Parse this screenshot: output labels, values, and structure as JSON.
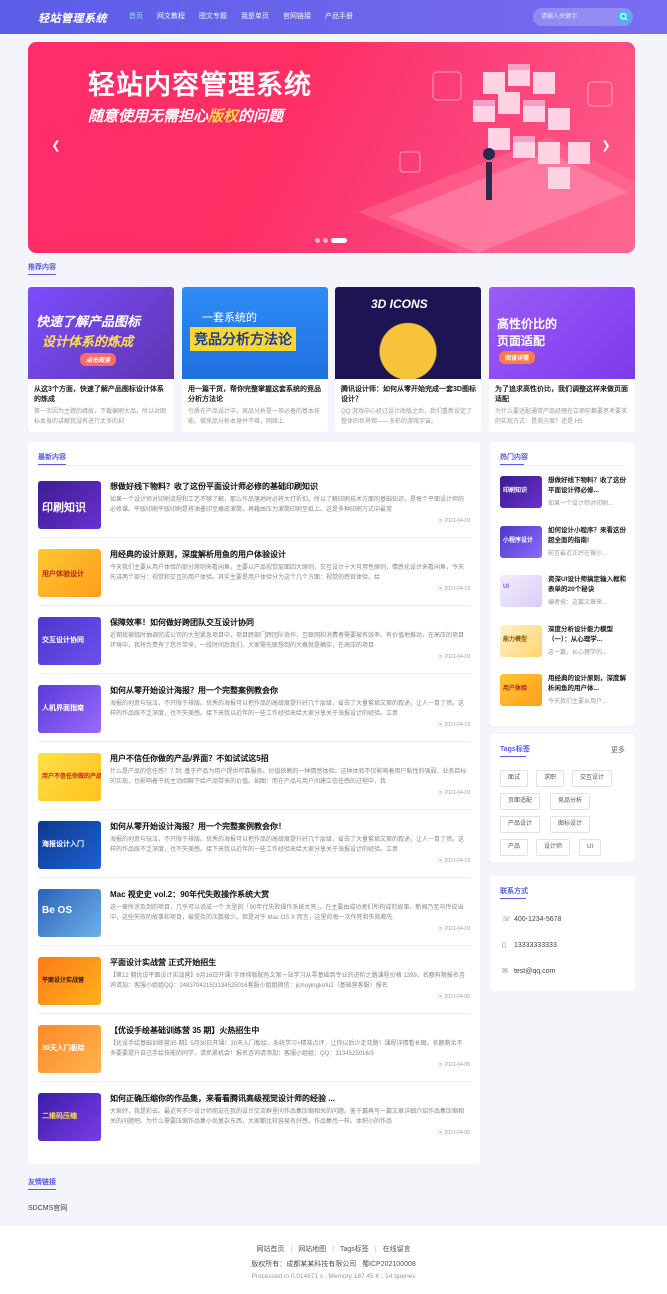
{
  "header": {
    "logo": "轻站管理系统",
    "nav": [
      "首页",
      "网文教程",
      "图文专题",
      "我是单页",
      "官网链接",
      "产品手册"
    ],
    "active_nav": "首页",
    "search_placeholder": "请输入关键字"
  },
  "banner": {
    "title": "轻站内容管理系统",
    "subtitle_pre": "随意使用无需担心",
    "subtitle_highlight": "版权",
    "subtitle_post": "的问题",
    "slides": 3,
    "active_slide": 3
  },
  "recommend": {
    "title": "推荐内容",
    "items": [
      {
        "image_text": [
          "快速了解产品图标",
          "设计体系的炼成",
          "点击阅读"
        ],
        "title": "从这3个方面，快速了解产品图标设计体系的炼成",
        "desc": "第一次因为主题的缘故，下载偏刷大品。所以对图标本身的讲解我没有进行太多的刻"
      },
      {
        "image_text": [
          "一套系统的",
          "竞品分析方法论"
        ],
        "title": "用一篇干货，帮你完整掌握这套系统的竞品分析方法论",
        "desc": "引质在产品设计中，竞品分析是一项必备的基本技能。做竞品分析本身并不难，网络上"
      },
      {
        "image_text": [
          "3D ICONS"
        ],
        "title": "腾讯设计师：如何从零开始完成一套3D图标设计？",
        "desc": "QQ 游戏中心经过设计改版之后，我们重新设定了整体的世界观——多彩的游戏宇宙。"
      },
      {
        "image_text": [
          "高性价比的",
          "页面适配",
          "阅读详情"
        ],
        "title": "为了追求高性价比，我们调整这样来做页面适配",
        "desc": "为什么要适配通常产品经理在立项前都要思考要求的实现方式：是测方案？还是 H5"
      }
    ]
  },
  "latest": {
    "title": "最新内容",
    "items": [
      {
        "thumb": "印刷知识",
        "title": "想做好线下物料？收了这份平面设计师必修的基础印刷知识",
        "desc": "如果一个设计师对印刷流程和工艺不够了解，那么作品落地时必将大打折扣。所以了解印刷技术方面的基础知识，是每个平面设计师的必修课。平版印刷平版印刷是将油墨印至橡皮滚筒，再藉由压力滚筒印刷至纸上。这是多种印刷方式中最常",
        "date": "2021-04-19"
      },
      {
        "thumb": "用户体验设计",
        "title": "用经典的设计原则，深度解析用鱼的用户体验设计",
        "desc": "今天我们主要从用户体验的部分原则来看闲鱼，主要以产品视觉层面四大原则，交互设计十大可用性原则，情感化设计来看闲鱼，今天先讲两个部分：视觉和交互的用户体验。其实主要是用户体验分为这个几个方面：视觉的感官体验，给",
        "date": "2021-04-19"
      },
      {
        "thumb": "交互设计协同",
        "title": "保障效率！如何做好跨团队交互设计协同",
        "desc": "近期我被临时抽调完成公司的大型紧急项目中，项目跨部门跨团队协作，互联网和消费者需要被有效率、有价值地推动，在高压的项目环境中，我将负责有了您许带来，一段时间后我们、大家需先联想到的大概就是确实，在高压的项目",
        "date": "2021-04-19"
      },
      {
        "thumb": "人机界面指南",
        "title": "如何从零开始设计海报？用一个完整案例教会你",
        "desc": "海报的创意与玩法，不只限于排版。优秀的海报可以把作品的高级度提升好几个层级，省去了大量繁琐文案的叙述，让人一目了然。这样的作品既不乏深度，也不失美感。接下来我以近年的一些工作经验来给大家分享关于海报设计的经验。立意",
        "date": "2021-04-19"
      },
      {
        "thumb": "用户不信任你做的产品?",
        "title": "用户不信任你做的产品/界面？不如试试这5招",
        "desc": "什么是产品的信任感？7 到: 基于产品为用户提供可靠服务。价值依赖的一种情感体验。这种体验不仅影响着用户黏性的强弱，业务目标的实现，也影响着干扰主动阅聊下给产品带来的价值。如图：而在产品与用户间建立信任感的过程中，我",
        "date": "2021-04-19"
      },
      {
        "thumb": "海报设计入门",
        "title": "如何从零开始设计海报？用一个完整案例教会你！",
        "desc": "海报的创意与玩法，不只限于排版。优秀的海报可以把作品的高级度提升好几个层级，省去了大量繁琐文案的叙述，让人一目了然。这样的作品既不乏深度，也不失美感。接下来我以近年的一些工作经验来给大家分享关于海报设计的经验。立意",
        "date": "2021-04-19"
      },
      {
        "thumb": "Be OS",
        "title": "Mac 视史史 vol.2：90年代失败操作系统大赏",
        "desc": "这一章所涉及到的项目，几乎可以说成一个 大型的「90年代失败操作系统大赏」，在主要由成功者们所构成的故事、新闻乃至与传说当中，这些失败的故事和项目，被提及的次数极少。但是对于 Mac OS X 而言，这里的每一次作死和失败都先",
        "date": "2021-04-19"
      },
      {
        "thumb": "平面设计实战营",
        "title": "平面设计实战营 正式开始招生",
        "desc": "【第12 期优设平面设计实战营】6月16日开课! 字体排版配色文案一站学习从零基础到专业的进阶之路课程价格 1399。名额有限报名咨询请加：客服小姐姐QQ：2483794215|3134525016客服小姐姐微信：jichuyingkefu2（基础营客服）报名",
        "date": "2021-04-05"
      },
      {
        "thumb": "30天入门板绘",
        "title": "【优设手绘基础训练营 35 期】火热招生中",
        "desc": "【优设手绘基础训练营35 期】5月30日开课！30天入门板绘、系统学习+精准点评，让你以后少走弯路！课程详情看长图。名额剩余不多要要提升自己手绘技能的同学，请抓紧机会！报名咨询请添加：客服小姐姐：QQ：3134525016/3",
        "date": "2021-04-05"
      },
      {
        "thumb": "二维码压缩",
        "title": "如何正确压缩你的作品集，来看看腾讯高级视觉设计师的经验 ...",
        "desc": "大家好，我是彩云。最近有不少设计师朋友在我的设计交流群里问作品集压缩相关的问题。鉴于篇再写一篇文章详细介绍作品集压缩相关的问题吧。为什么需要压缩作品集小尚复杂东西，大家都比较容易有好感，作品集也一样。体积小的作品",
        "date": "2021-04-05"
      }
    ]
  },
  "hot": {
    "title": "热门内容",
    "items": [
      {
        "thumb": "印刷知识",
        "title": "想做好线下物料？收了这份平面设计师必修...",
        "desc": "如果一个设计师对印刷..."
      },
      {
        "thumb": "小程序设计",
        "title": "如何设计小程序？来看这份超全面的指南!",
        "desc": "前言最近正好在做小..."
      },
      {
        "thumb": "UI",
        "title": "资深UI设计师搞定输入框和表单的20个秘诀",
        "desc": "编者按：这篇文章来..."
      },
      {
        "thumb": "能力模型",
        "title": "深度分析设计能力模型（一）：从心理学...",
        "desc": "这一篇，从心理学的..."
      },
      {
        "thumb": "用户体验",
        "title": "用经典的设计原则，深度解析闲鱼的用户体...",
        "desc": "今天我们主要从用户..."
      }
    ]
  },
  "tags": {
    "title": "Tags标签",
    "more": "更多",
    "items": [
      "面试",
      "求职",
      "交互设计",
      "页面适配",
      "竞品分析",
      "产品设计",
      "图标设计",
      "产品",
      "设计师",
      "UI"
    ]
  },
  "contact": {
    "title": "联系方式",
    "phone": "400-1234-5678",
    "mobile": "13333333333",
    "email": "test@qq.com"
  },
  "friend_links": {
    "title": "友情链接",
    "items": [
      "SDCMS官网"
    ]
  },
  "footer": {
    "links": [
      "网站首页",
      "网站地图",
      "Tags标签",
      "在线留言"
    ],
    "copyright": "版权所有：成都某某科技有限公司",
    "icp": "蜀ICP202100008",
    "processed": "Processed in 0.014671 s , Memory 187.45 K , 14 queries"
  },
  "colors": {
    "primary": "#5b5de8",
    "banner": "#ff2e63",
    "accent": "#3dbbf5"
  }
}
